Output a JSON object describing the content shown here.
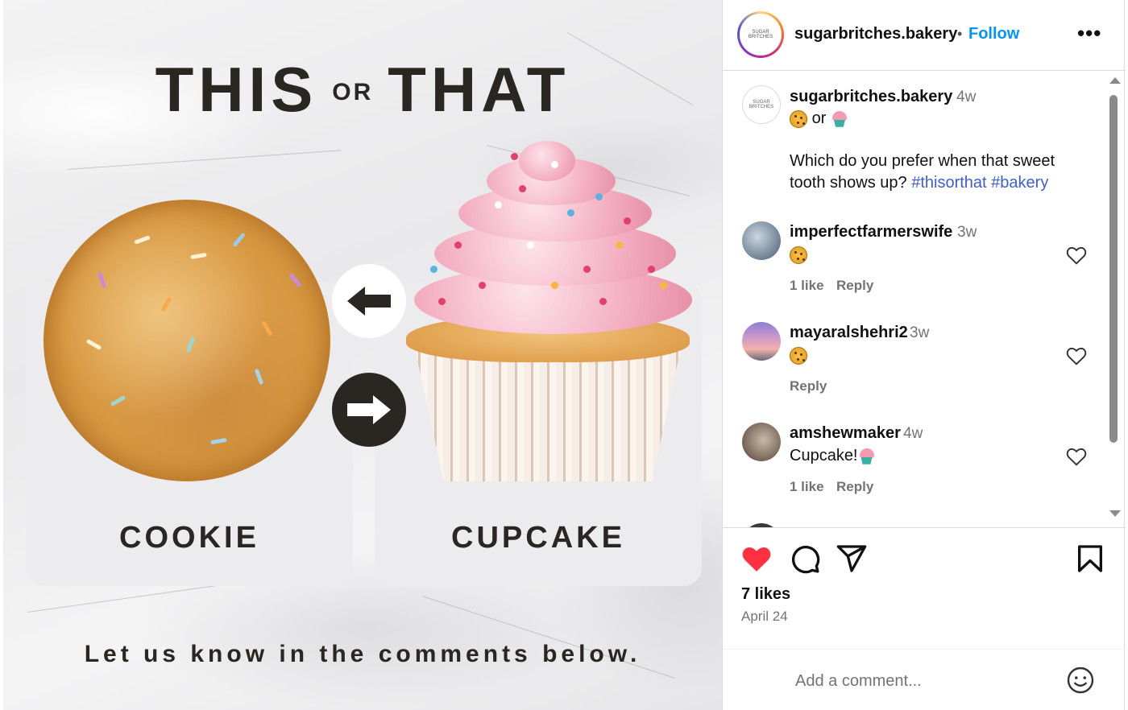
{
  "post_image": {
    "title_left": "THIS",
    "title_mid": "OR",
    "title_right": "THAT",
    "left_label": "COOKIE",
    "right_label": "CUPCAKE",
    "caption": "Let us know in the comments below."
  },
  "header": {
    "username": "sugarbritches.bakery",
    "separator": "•",
    "follow_label": "Follow",
    "more_label": "•••",
    "avatar_text": "SUGAR BRITCHES"
  },
  "caption": {
    "username": "sugarbritches.bakery",
    "time": "4w",
    "or_text": "or",
    "text": "Which do you prefer when that sweet tooth shows up?",
    "hashtag1": "#thisorthat",
    "hashtag2": "#bakery"
  },
  "comments": [
    {
      "username": "imperfectfarmerswife",
      "time": "3w",
      "emoji": "cookie",
      "likes": "1 like",
      "reply": "Reply"
    },
    {
      "username": "mayaralshehri2",
      "time": "3w",
      "emoji": "cookie",
      "reply": "Reply"
    },
    {
      "username": "amshewmaker",
      "time": "4w",
      "text": "Cupcake!",
      "emoji": "cupcake",
      "likes": "1 like",
      "reply": "Reply"
    }
  ],
  "actions": {
    "liked": true,
    "likes": "7 likes",
    "date": "April 24"
  },
  "add_comment": {
    "placeholder": "Add a comment..."
  },
  "icons": [
    "heart-icon",
    "comment-icon",
    "share-icon",
    "bookmark-icon",
    "emoji-icon",
    "more-icon"
  ],
  "colors": {
    "accent": "#0095f6",
    "liked": "#ff3040",
    "hashtag": "#3d5dd6"
  }
}
